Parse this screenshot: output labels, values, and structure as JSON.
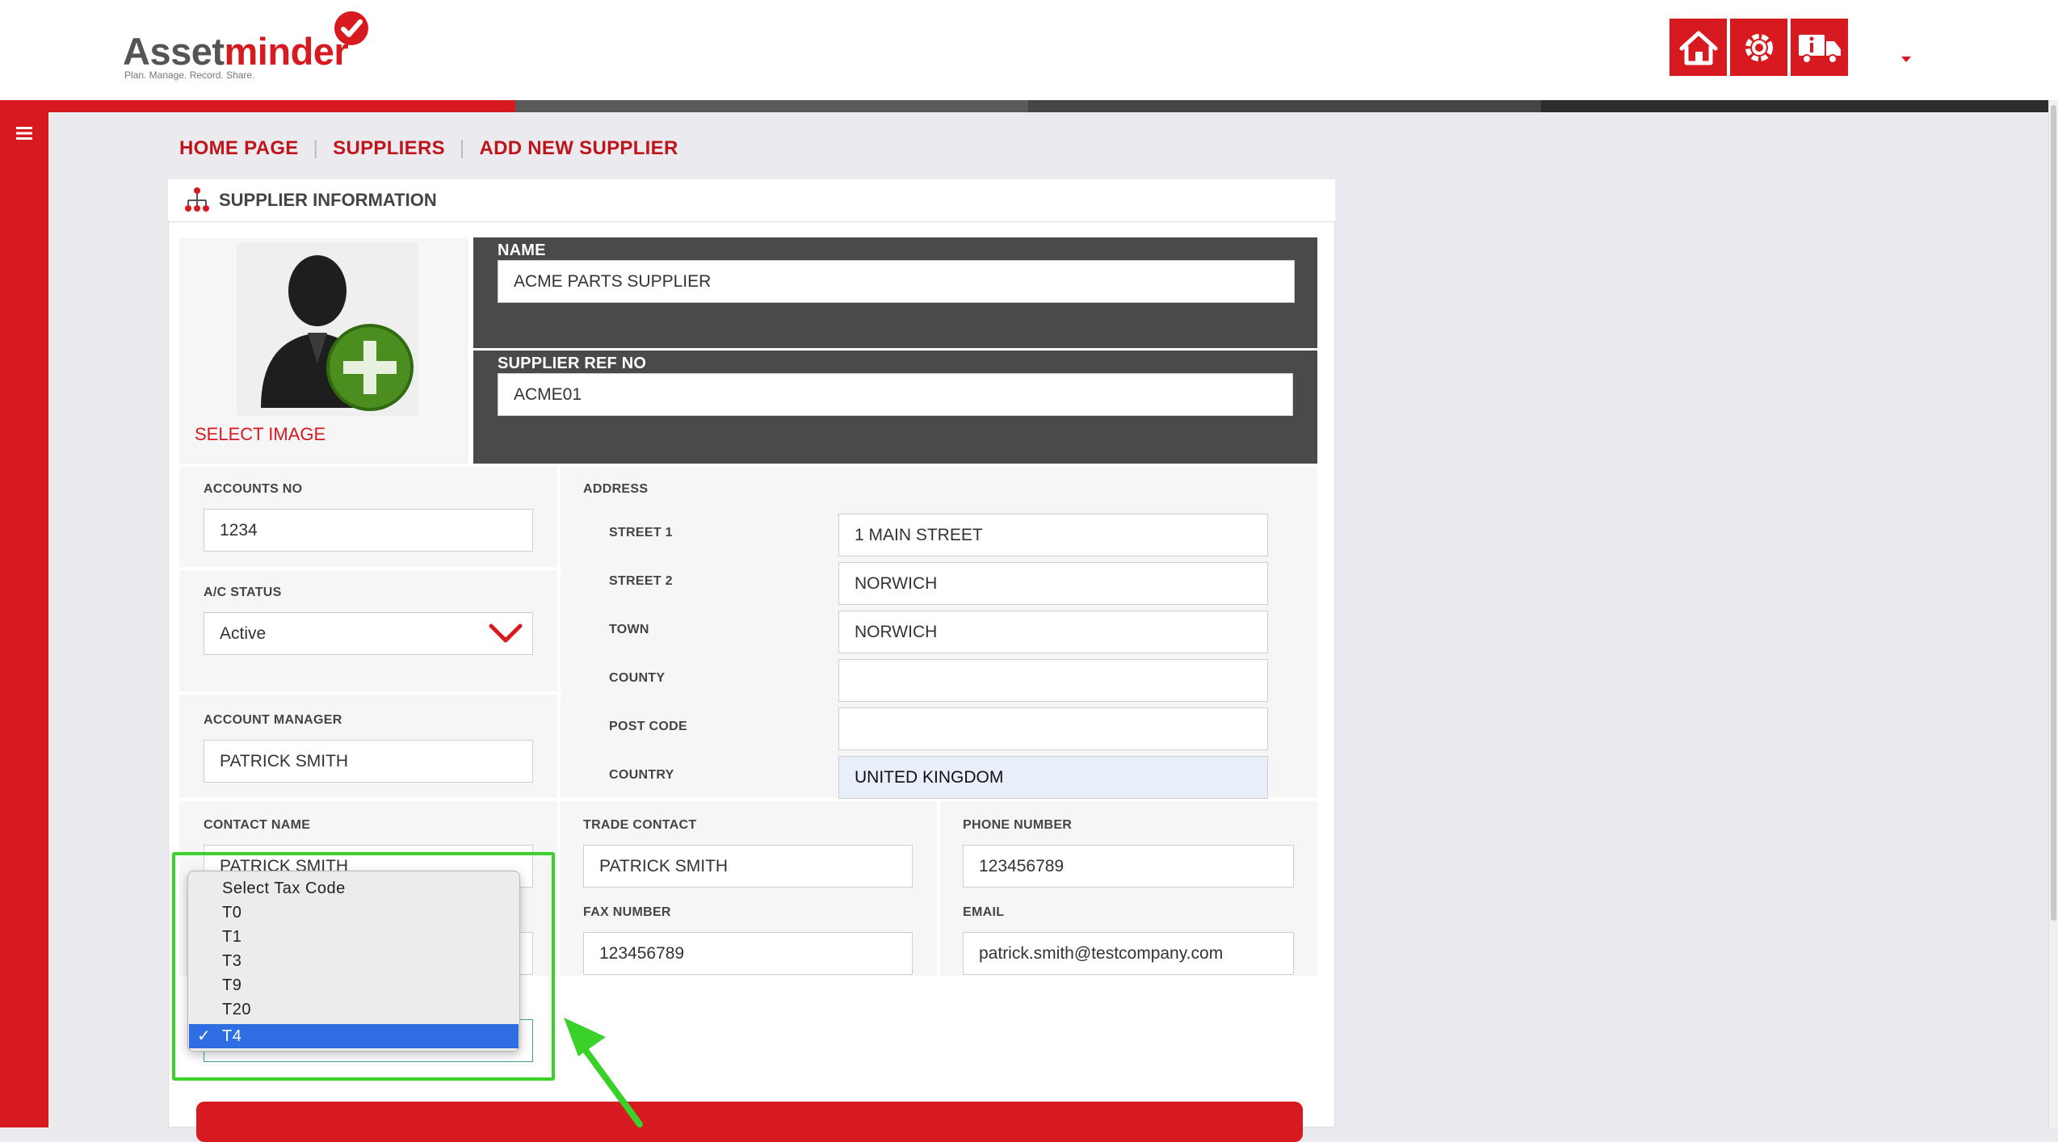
{
  "header": {
    "logo": {
      "word_part1": "Asset",
      "word_part2": "minder",
      "tagline": "Plan. Manage. Record. Share."
    },
    "nav_icons": [
      "home-icon",
      "settings-cog-icon",
      "vehicle-info-icon"
    ],
    "colorbar": [
      "#d71920",
      "#5a5a5a",
      "#454545",
      "#2c2c2c"
    ]
  },
  "breadcrumb": {
    "home": "HOME PAGE",
    "suppliers": "SUPPLIERS",
    "current": "ADD NEW SUPPLIER",
    "separator": "|"
  },
  "card": {
    "title": "SUPPLIER INFORMATION",
    "select_image": "SELECT IMAGE",
    "name": {
      "label": "NAME",
      "value": "ACME PARTS SUPPLIER"
    },
    "supplier_ref": {
      "label": "SUPPLIER REF NO",
      "value": "ACME01"
    },
    "accounts_no": {
      "label": "ACCOUNTS NO",
      "value": "1234"
    },
    "ac_status": {
      "label": "A/C STATUS",
      "value": "Active"
    },
    "account_manager": {
      "label": "ACCOUNT MANAGER",
      "value": "PATRICK SMITH"
    },
    "address": {
      "label": "ADDRESS",
      "street1": {
        "label": "STREET 1",
        "value": "1 MAIN STREET"
      },
      "street2": {
        "label": "STREET 2",
        "value": "NORWICH"
      },
      "town": {
        "label": "TOWN",
        "value": "NORWICH"
      },
      "county": {
        "label": "COUNTY",
        "value": ""
      },
      "post_code": {
        "label": "POST CODE",
        "value": ""
      },
      "country": {
        "label": "COUNTRY",
        "value": "UNITED KINGDOM"
      }
    },
    "contact_name": {
      "label": "CONTACT NAME",
      "value": "PATRICK SMITH"
    },
    "trade_contact": {
      "label": "TRADE CONTACT",
      "value": "PATRICK SMITH"
    },
    "phone_number": {
      "label": "PHONE NUMBER",
      "value": "123456789"
    },
    "fax_number": {
      "label": "FAX NUMBER",
      "value": "123456789"
    },
    "email": {
      "label": "EMAIL",
      "value": "patrick.smith@testcompany.com"
    }
  },
  "tax_dropdown": {
    "options": [
      "Select Tax Code",
      "T0",
      "T1",
      "T3",
      "T9",
      "T20",
      "T4"
    ],
    "selected": "T4",
    "check_glyph": "✓"
  },
  "colors": {
    "brand_red": "#d71920",
    "dark_panel": "#4a4a4a",
    "highlight_green": "#3ad12b",
    "selection_blue": "#2f6ee2"
  }
}
